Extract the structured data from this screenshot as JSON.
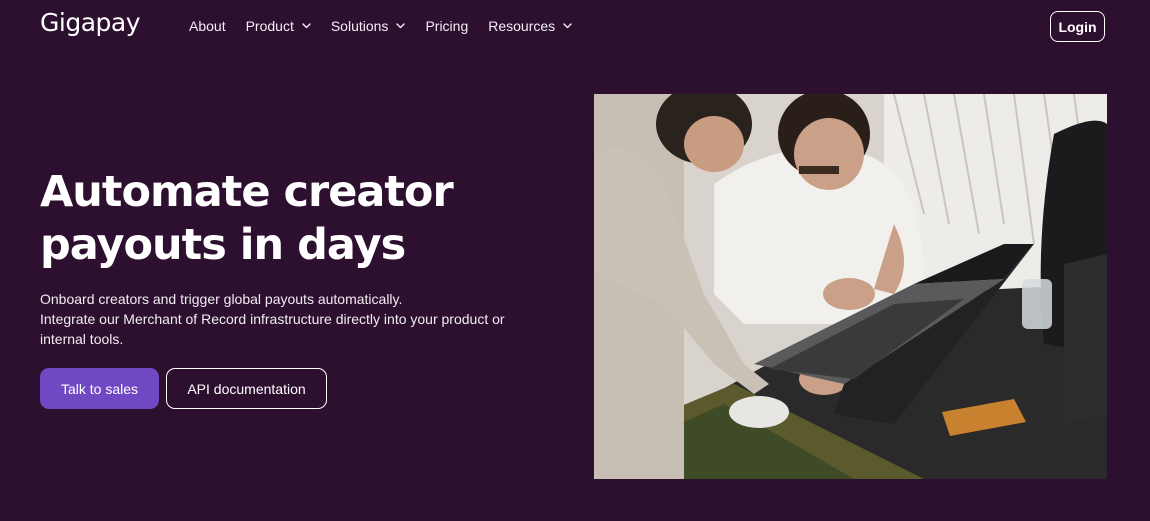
{
  "brand": {
    "logo_text": "Gigapay"
  },
  "nav": {
    "items": [
      {
        "label": "About",
        "has_dropdown": false
      },
      {
        "label": "Product",
        "has_dropdown": true
      },
      {
        "label": "Solutions",
        "has_dropdown": true
      },
      {
        "label": "Pricing",
        "has_dropdown": false
      },
      {
        "label": "Resources",
        "has_dropdown": true
      }
    ],
    "login_label": "Login"
  },
  "hero": {
    "title_line1": "Automate creator",
    "title_line2": "payouts in days",
    "subtitle_line1": "Onboard creators and trigger global payouts automatically.",
    "subtitle_line2": "Integrate our Merchant of Record infrastructure directly into your product or",
    "subtitle_line3": "internal tools.",
    "primary_cta": "Talk to sales",
    "secondary_cta": "API documentation"
  },
  "colors": {
    "background": "#2d1030",
    "primary_button": "#7048c3",
    "text": "#ffffff"
  }
}
